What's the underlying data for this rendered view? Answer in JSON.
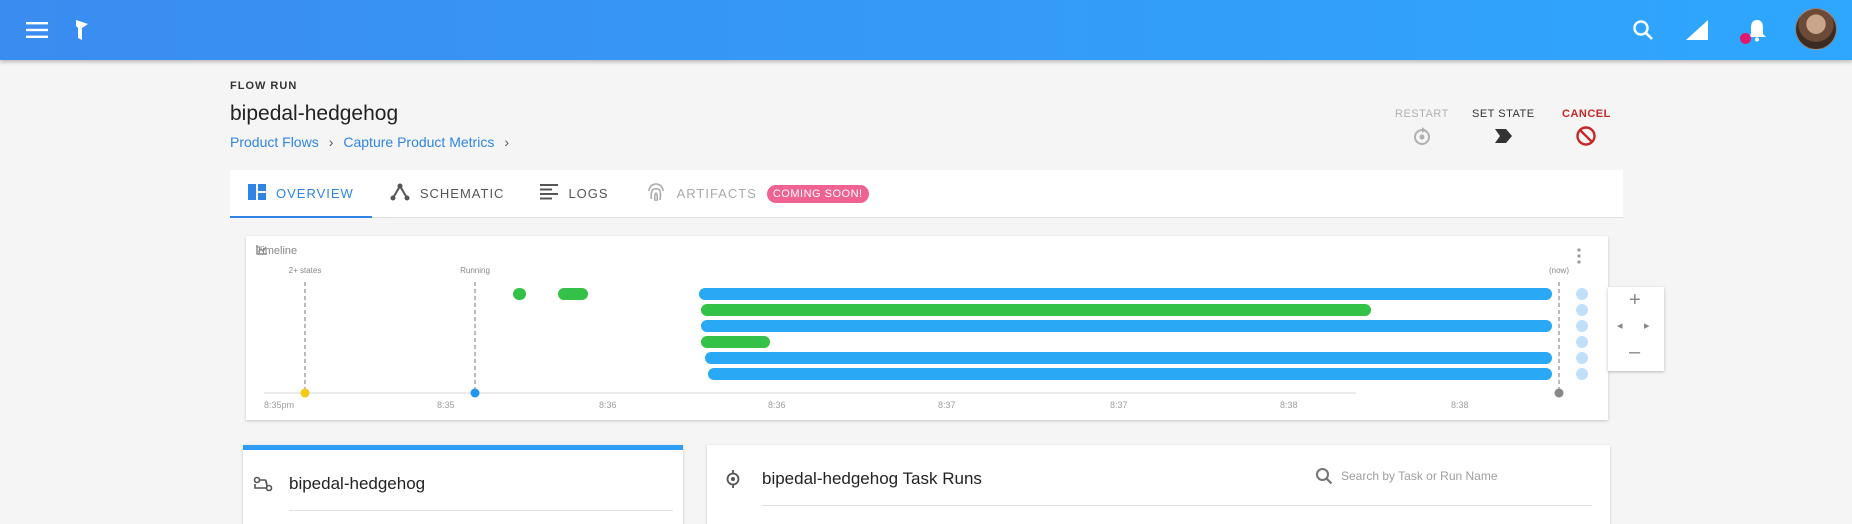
{
  "appbar": {
    "icons": [
      "menu-icon",
      "prefect-logo-icon",
      "search-icon",
      "signal-icon",
      "bell-icon"
    ],
    "colors": {
      "gradient_start": "#3b8cf0",
      "gradient_end": "#2ea7ff",
      "notification_dot": "#e2176f"
    }
  },
  "header": {
    "eyebrow": "FLOW RUN",
    "title": "bipedal-hedgehog",
    "breadcrumbs": [
      "Product Flows",
      "Capture Product Metrics"
    ]
  },
  "actions": {
    "restart": "RESTART",
    "set_state": "SET STATE",
    "cancel": "CANCEL"
  },
  "tabs": [
    {
      "label": "OVERVIEW",
      "icon": "overview-icon",
      "active": true
    },
    {
      "label": "SCHEMATIC",
      "icon": "schematic-icon",
      "active": false
    },
    {
      "label": "LOGS",
      "icon": "logs-icon",
      "active": false
    },
    {
      "label": "ARTIFACTS",
      "icon": "fingerprint-icon",
      "active": false,
      "disabled": true,
      "badge": "COMING SOON!"
    }
  ],
  "timeline": {
    "label": "Timeline",
    "markers": [
      {
        "label": "2+ states",
        "color": "#f6c915"
      },
      {
        "label": "Running",
        "color": "#2196f3"
      },
      {
        "label": "(now)",
        "color": "#888888"
      }
    ],
    "ticks": [
      "8:35pm",
      "8:35",
      "8:36",
      "8:36",
      "8:37",
      "8:37",
      "8:38",
      "8:38"
    ],
    "colors": {
      "running": "#29a8f5",
      "completed": "#34c147",
      "scheduled": "#bfdffb"
    }
  },
  "flow_card": {
    "title": "bipedal-hedgehog",
    "icon": "flow-icon"
  },
  "task_runs_card": {
    "title": "bipedal-hedgehog Task Runs",
    "icon": "task-run-icon",
    "search_placeholder": "Search by Task or Run Name"
  }
}
